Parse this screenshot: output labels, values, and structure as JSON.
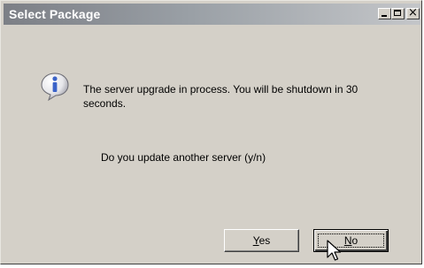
{
  "window": {
    "title": "Select Package",
    "controls": {
      "minimize": "minimize-icon",
      "maximize": "maximize-icon",
      "close": "close-icon",
      "close_glyph": "×"
    }
  },
  "dialog": {
    "icon": "info-icon",
    "message": "The server upgrade in process. You will be shutdown in 30 seconds.",
    "question": "Do you update another server (y/n)"
  },
  "buttons": {
    "yes": {
      "mnemonic": "Y",
      "rest": "es"
    },
    "no": {
      "mnemonic": "N",
      "rest": "o"
    }
  },
  "colors": {
    "window_bg": "#d4d0c8",
    "title_gradient_start": "#7c7f86",
    "title_gradient_end": "#c4c6c9",
    "info_icon_blue": "#3b63c8"
  }
}
